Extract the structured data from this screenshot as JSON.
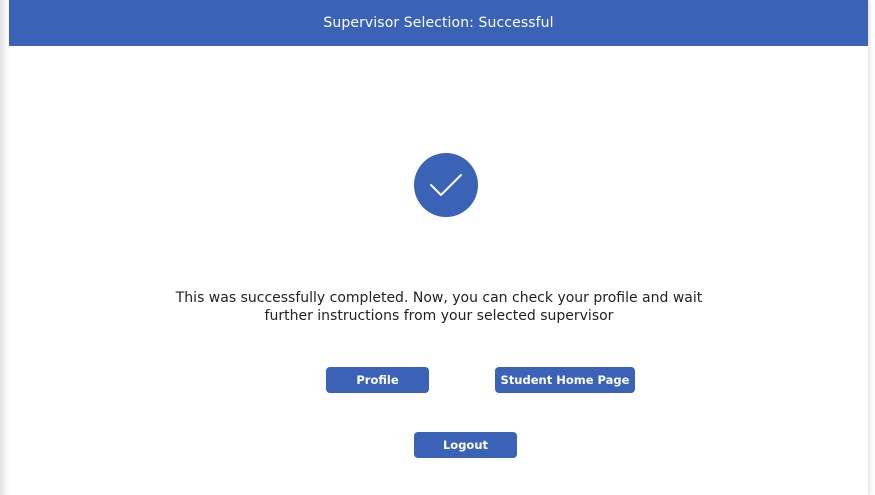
{
  "header": {
    "title": "Supervisor Selection: Successful",
    "background_color": "#3a62b6"
  },
  "success_indicator": {
    "icon": "checkmark-icon",
    "color": "#3a62b6"
  },
  "message": {
    "line1": "This was successfully completed. Now, you can check your profile and wait",
    "line2": "further instructions from your selected supervisor"
  },
  "buttons": {
    "profile_label": "Profile",
    "student_home_label": "Student Home Page",
    "logout_label": "Logout"
  },
  "accent_color": "#3a62b6"
}
